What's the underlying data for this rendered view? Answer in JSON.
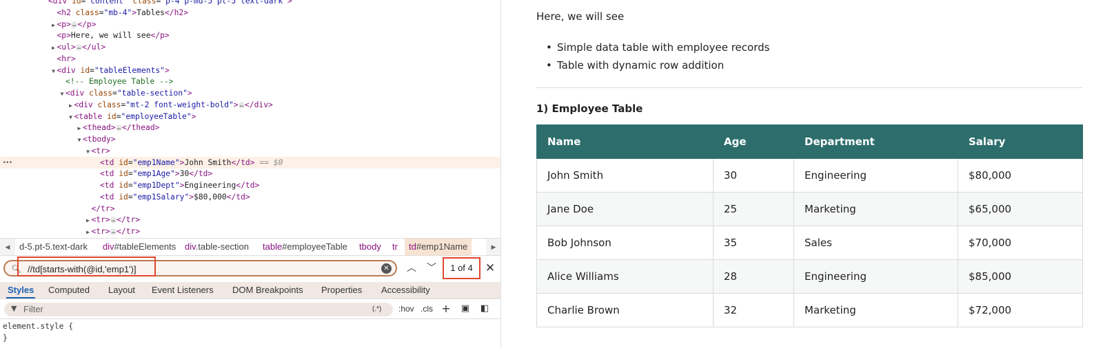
{
  "devtools": {
    "dom_lines": [
      {
        "indent": 4,
        "tri": "",
        "html": "<span class='tag'>&lt;div</span> <span class='an'>id</span>=<span class='av'>\"content\"</span> <span class='an'>class</span>=<span class='av'>\"p-4 p-md-5 pt-5 text-dark\"</span><span class='tag'>&gt;</span>"
      },
      {
        "indent": 5,
        "tri": "",
        "html": "<span class='tag'>&lt;h2</span> <span class='an'>class</span>=<span class='av'>\"mb-4\"</span><span class='tag'>&gt;</span>Tables<span class='tag'>&lt;/h2&gt;</span>"
      },
      {
        "indent": 5,
        "tri": "▶",
        "html": "<span class='tag'>&lt;p&gt;</span><span class='ell'>…</span><span class='tag'>&lt;/p&gt;</span>"
      },
      {
        "indent": 5,
        "tri": "",
        "html": "<span class='tag'>&lt;p&gt;</span>Here, we will see<span class='tag'>&lt;/p&gt;</span>"
      },
      {
        "indent": 5,
        "tri": "▶",
        "html": "<span class='tag'>&lt;ul&gt;</span><span class='ell'>…</span><span class='tag'>&lt;/ul&gt;</span>"
      },
      {
        "indent": 5,
        "tri": "",
        "html": "<span class='tag'>&lt;hr&gt;</span>"
      },
      {
        "indent": 5,
        "tri": "▼",
        "html": "<span class='tag'>&lt;div</span> <span class='an'>id</span>=<span class='av'>\"tableElements\"</span><span class='tag'>&gt;</span>"
      },
      {
        "indent": 6,
        "tri": "",
        "html": "<span class='cm'>&lt;!-- Employee Table --&gt;</span>"
      },
      {
        "indent": 6,
        "tri": "▼",
        "html": "<span class='tag'>&lt;div</span> <span class='an'>class</span>=<span class='av'>\"table-section\"</span><span class='tag'>&gt;</span>"
      },
      {
        "indent": 7,
        "tri": "▶",
        "html": "<span class='tag'>&lt;div</span> <span class='an'>class</span>=<span class='av'>\"mt-2 font-weight-bold\"</span><span class='tag'>&gt;</span><span class='ell'>…</span><span class='tag'>&lt;/div&gt;</span>"
      },
      {
        "indent": 7,
        "tri": "▼",
        "html": "<span class='tag'>&lt;table</span> <span class='an'>id</span>=<span class='av'>\"employeeTable\"</span><span class='tag'>&gt;</span>"
      },
      {
        "indent": 8,
        "tri": "▶",
        "html": "<span class='tag'>&lt;thead&gt;</span><span class='ell'>…</span><span class='tag'>&lt;/thead&gt;</span>"
      },
      {
        "indent": 8,
        "tri": "▼",
        "html": "<span class='tag'>&lt;tbody&gt;</span>"
      },
      {
        "indent": 9,
        "tri": "▼",
        "html": "<span class='tag'>&lt;tr&gt;</span>"
      },
      {
        "indent": 10,
        "tri": "",
        "selected": true,
        "html": "<span class='tag'>&lt;td</span> <span class='an'>id</span>=<span class='av'>\"emp1Name\"</span><span class='tag'>&gt;</span>John Smith<span class='tag'>&lt;/td&gt;</span> <span class='eq0'>== $0</span>"
      },
      {
        "indent": 10,
        "tri": "",
        "html": "<span class='tag'>&lt;td</span> <span class='an'>id</span>=<span class='av'>\"emp1Age\"</span><span class='tag'>&gt;</span>30<span class='tag'>&lt;/td&gt;</span>"
      },
      {
        "indent": 10,
        "tri": "",
        "html": "<span class='tag'>&lt;td</span> <span class='an'>id</span>=<span class='av'>\"emp1Dept\"</span><span class='tag'>&gt;</span>Engineering<span class='tag'>&lt;/td&gt;</span>"
      },
      {
        "indent": 10,
        "tri": "",
        "html": "<span class='tag'>&lt;td</span> <span class='an'>id</span>=<span class='av'>\"emp1Salary\"</span><span class='tag'>&gt;</span>$80,000<span class='tag'>&lt;/td&gt;</span>"
      },
      {
        "indent": 9,
        "tri": "",
        "html": "<span class='tag'>&lt;/tr&gt;</span>"
      },
      {
        "indent": 9,
        "tri": "▶",
        "html": "<span class='tag'>&lt;tr&gt;</span><span class='ell'>…</span><span class='tag'>&lt;/tr&gt;</span>"
      },
      {
        "indent": 9,
        "tri": "▶",
        "html": "<span class='tag'>&lt;tr&gt;</span><span class='ell'>…</span><span class='tag'>&lt;/tr&gt;</span>"
      }
    ],
    "breadcrumbs": [
      {
        "tag": "d-5.pt-5.text-dark",
        "sel": "",
        "active": false
      },
      {
        "tag": "div",
        "sel": "#tableElements",
        "active": false
      },
      {
        "tag": "div",
        "sel": ".table-section",
        "active": false
      },
      {
        "tag": "table",
        "sel": "#employeeTable",
        "active": false
      },
      {
        "tag": "tbody",
        "sel": "",
        "active": false
      },
      {
        "tag": "tr",
        "sel": "",
        "active": false
      },
      {
        "tag": "td",
        "sel": "#emp1Name",
        "active": true
      }
    ],
    "search": {
      "query": "//td[starts-with(@id,'emp1')]",
      "match_count": "1 of 4"
    },
    "style_tabs": [
      "Styles",
      "Computed",
      "Layout",
      "Event Listeners",
      "DOM Breakpoints",
      "Properties",
      "Accessibility"
    ],
    "active_tab": "Styles",
    "filter": {
      "placeholder": "Filter",
      "regex_label": "(.*)",
      "hov_label": ":hov",
      "cls_label": ".cls"
    },
    "styles_lines": [
      "element.style {",
      "}"
    ]
  },
  "page": {
    "intro": "Here, we will see",
    "bullets": [
      "Simple data table with employee records",
      "Table with dynamic row addition"
    ],
    "section_title": "1) Employee Table",
    "table": {
      "headers": [
        "Name",
        "Age",
        "Department",
        "Salary"
      ],
      "rows": [
        [
          "John Smith",
          "30",
          "Engineering",
          "$80,000"
        ],
        [
          "Jane Doe",
          "25",
          "Marketing",
          "$65,000"
        ],
        [
          "Bob Johnson",
          "35",
          "Sales",
          "$70,000"
        ],
        [
          "Alice Williams",
          "28",
          "Engineering",
          "$85,000"
        ],
        [
          "Charlie Brown",
          "32",
          "Marketing",
          "$72,000"
        ]
      ]
    }
  },
  "colors": {
    "table_header_bg": "#2d6e6c",
    "selected_line_bg": "#fdf1e7",
    "highlight_border": "#e0462f"
  }
}
